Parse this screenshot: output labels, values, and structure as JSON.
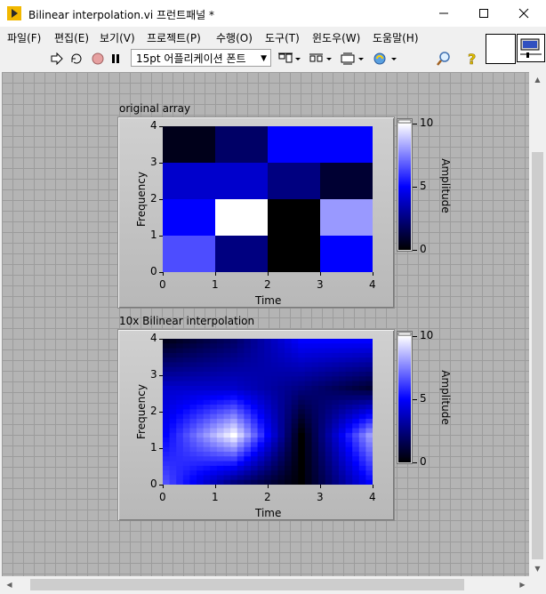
{
  "window": {
    "title": "Bilinear interpolation.vi 프런트패널 *",
    "minimize_icon": "minimize-icon",
    "maximize_icon": "maximize-icon",
    "close_icon": "close-icon"
  },
  "menu": {
    "items": [
      "파일(F)",
      "편집(E)",
      "보기(V)",
      "프로젝트(P)",
      "수행(O)",
      "도구(T)",
      "윈도우(W)",
      "도움말(H)"
    ]
  },
  "toolbar": {
    "font_selector": "15pt 어플리케이션 폰트",
    "icons": [
      "run-arrow-icon",
      "run-continuously-icon",
      "abort-icon",
      "pause-icon",
      "align-objects-icon",
      "distribute-objects-icon",
      "resize-objects-icon",
      "reorder-icon",
      "search-icon",
      "context-help-icon"
    ]
  },
  "graphs": [
    {
      "label": "original array",
      "xlabel": "Time",
      "ylabel": "Frequency",
      "scale_label": "Amplitude",
      "x_ticks": [
        "0",
        "1",
        "2",
        "3",
        "4"
      ],
      "y_ticks": [
        "4",
        "3",
        "2",
        "1",
        "0"
      ],
      "scale_ticks": [
        "10",
        "5",
        "0"
      ]
    },
    {
      "label": "10x Bilinear interpolation",
      "xlabel": "Time",
      "ylabel": "Frequency",
      "scale_label": "Amplitude",
      "x_ticks": [
        "0",
        "1",
        "2",
        "3",
        "4"
      ],
      "y_ticks": [
        "4",
        "3",
        "2",
        "1",
        "0"
      ],
      "scale_ticks": [
        "10",
        "5",
        "0"
      ]
    }
  ],
  "chart_data": [
    {
      "type": "heatmap",
      "title": "original array",
      "xlabel": "Time",
      "ylabel": "Frequency",
      "xlim": [
        0,
        4
      ],
      "ylim": [
        0,
        4
      ],
      "zlim": [
        0,
        10
      ],
      "colorbar_label": "Amplitude",
      "colormap": [
        "#000000",
        "#0000ff",
        "#ffffff"
      ],
      "rows_y_top_to_bottom": [
        [
          0.5,
          2.0,
          5.0,
          5.0
        ],
        [
          4.0,
          4.0,
          2.5,
          1.0
        ],
        [
          5.0,
          10.0,
          0.0,
          8.0
        ],
        [
          6.5,
          2.5,
          0.0,
          5.0
        ]
      ]
    },
    {
      "type": "heatmap",
      "title": "10x Bilinear interpolation",
      "xlabel": "Time",
      "ylabel": "Frequency",
      "xlim": [
        0,
        4
      ],
      "ylim": [
        0,
        4
      ],
      "zlim": [
        0,
        10
      ],
      "colorbar_label": "Amplitude",
      "colormap": [
        "#000000",
        "#0000ff",
        "#ffffff"
      ],
      "interpolation_factor": 10,
      "source_rows_y_top_to_bottom": [
        [
          0.5,
          2.0,
          5.0,
          5.0
        ],
        [
          4.0,
          4.0,
          2.5,
          1.0
        ],
        [
          5.0,
          10.0,
          0.0,
          8.0
        ],
        [
          6.5,
          2.5,
          0.0,
          5.0
        ]
      ]
    }
  ]
}
